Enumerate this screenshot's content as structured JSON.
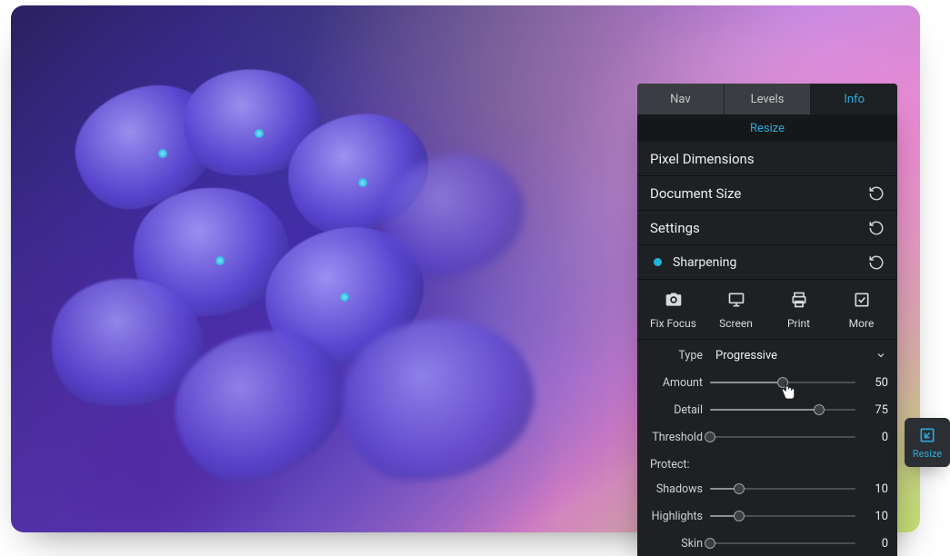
{
  "tabs": {
    "nav": "Nav",
    "levels": "Levels",
    "info": "Info",
    "active": "info"
  },
  "mode": {
    "label": "Resize"
  },
  "sections": {
    "pixel_dimensions": "Pixel Dimensions",
    "document_size": "Document Size",
    "settings": "Settings",
    "sharpening": "Sharpening"
  },
  "presets": {
    "fix_focus": "Fix Focus",
    "screen": "Screen",
    "print": "Print",
    "more": "More"
  },
  "type": {
    "label": "Type",
    "value": "Progressive"
  },
  "sliders": {
    "amount": {
      "label": "Amount",
      "value": 50,
      "min": 0,
      "max": 100
    },
    "detail": {
      "label": "Detail",
      "value": 75,
      "min": 0,
      "max": 100
    },
    "threshold": {
      "label": "Threshold",
      "value": 0,
      "min": 0,
      "max": 100
    }
  },
  "protect": {
    "label": "Protect:",
    "shadows": {
      "label": "Shadows",
      "value": 10,
      "min": 0,
      "max": 50
    },
    "highlights": {
      "label": "Highlights",
      "value": 10,
      "min": 0,
      "max": 50
    },
    "skin": {
      "label": "Skin",
      "value": 0,
      "min": 0,
      "max": 50
    }
  },
  "float_tab": {
    "label": "Resize"
  }
}
